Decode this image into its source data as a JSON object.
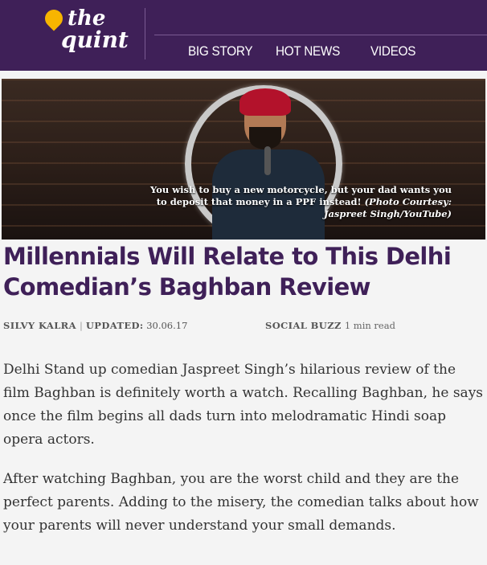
{
  "header": {
    "logo_line1": "the",
    "logo_line2": "quint",
    "nav": [
      "BIG STORY",
      "HOT NEWS",
      "VIDEOS"
    ],
    "brand_color": "#3f2058",
    "logo_accent": "#f7b500"
  },
  "hero": {
    "caption_main": "You wish to buy a new motorcycle, but your dad wants you to deposit that money in a PPF instead!",
    "caption_credit": "(Photo Courtesy: Jaspreet Singh/YouTube)"
  },
  "article": {
    "title": "Millennials Will Relate to This Delhi Comedian’s Baghban Review",
    "author": "SILVY KALRA",
    "updated_label": "UPDATED:",
    "updated_date": "30.06.17",
    "category": "SOCIAL BUZZ",
    "read_time": "1 min read",
    "paragraphs": [
      "Delhi Stand up comedian Jaspreet Singh’s hilarious review of the film Baghban is definitely worth a watch. Recalling Baghban, he says once the film begins all dads turn into melodramatic Hindi soap opera actors.",
      "After watching Baghban, you are the worst child and they are the perfect parents. Adding to the misery, the comedian talks about how your parents will never understand your small demands."
    ]
  }
}
